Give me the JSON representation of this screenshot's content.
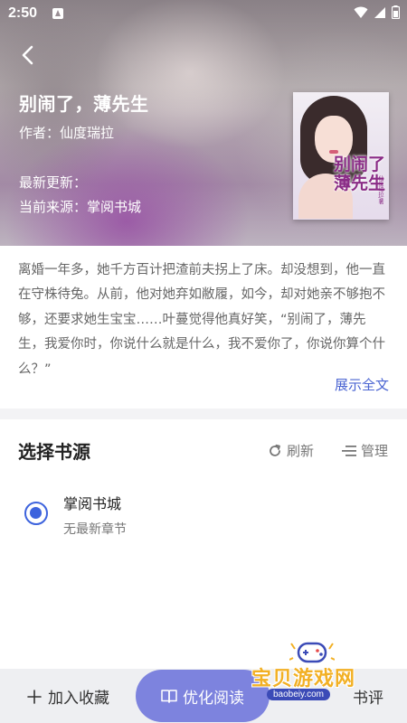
{
  "status_bar": {
    "time": "2:50",
    "icons": [
      "app-notification-icon",
      "wifi-icon",
      "cell-signal-icon",
      "battery-icon"
    ]
  },
  "header": {
    "back_icon": "back-arrow-icon"
  },
  "book": {
    "title": "别闹了，薄先生",
    "author": "作者：仙度瑞拉",
    "latest_update": "最新更新：",
    "current_source": "当前来源：掌阅书城",
    "cover_title_line1": "别闹了",
    "cover_title_line2": "薄先生",
    "cover_author": "仙度瑞拉/著"
  },
  "summary": {
    "text": "离婚一年多，她千方百计把渣前夫拐上了床。却没想到，他一直在守株待兔。从前，他对她弃如敝履，如今，却对她亲不够抱不够，还要求她生宝宝……叶蔓觉得他真好笑，“别闹了，薄先生，我爱你时，你说什么就是什么，我不爱你了，你说你算个什么？”",
    "show_all": "展示全文"
  },
  "source_section": {
    "title": "选择书源",
    "refresh": "刷新",
    "manage": "管理",
    "sources": [
      {
        "name": "掌阅书城",
        "sub": "无最新章节",
        "selected": true
      }
    ]
  },
  "bottom_bar": {
    "add_bookshelf": "加入收藏",
    "read": "优化阅读",
    "review": "书评"
  },
  "watermark": {
    "text": "宝贝游戏网",
    "url": "baobeiy.com"
  },
  "colors": {
    "accent": "#3d63dd",
    "read_button": "#7d83de",
    "link": "#4a64d2",
    "watermark": "#f2b024"
  }
}
